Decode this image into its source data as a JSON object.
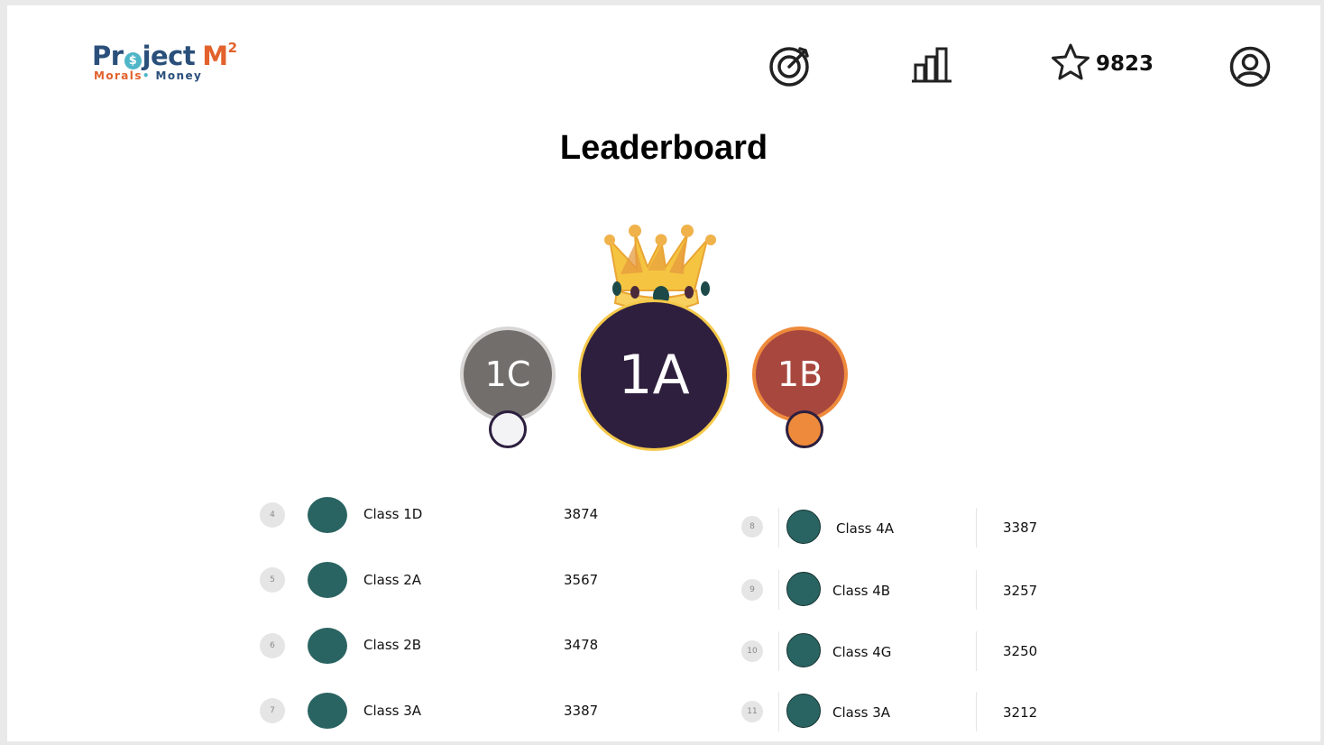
{
  "logo": {
    "part1": "Pr",
    "o": "$",
    "part2": "ject",
    "m": "M",
    "sup": "2",
    "tag_word1": "Morals",
    "tag_dot": "•",
    "tag_word2": "Money"
  },
  "header": {
    "icons": [
      "target-icon",
      "bar-chart-icon",
      "star-icon",
      "user-circle-icon"
    ],
    "stars": "9823"
  },
  "title": "Leaderboard",
  "podium": {
    "first": {
      "label": "1A",
      "color": "#2f1f3e",
      "ring": "#f5c94a"
    },
    "second": {
      "label": "1C",
      "color": "#726e6b",
      "ring": "#d9d6d6",
      "medal": "#f3f2f5"
    },
    "third": {
      "label": "1B",
      "color": "#a8473e",
      "ring": "#ee8a3c",
      "medal": "#ee8a3c"
    }
  },
  "left_list": [
    {
      "rank": "4",
      "name": "Class 1D",
      "score": "3874"
    },
    {
      "rank": "5",
      "name": "Class 2A",
      "score": "3567"
    },
    {
      "rank": "6",
      "name": "Class 2B",
      "score": "3478"
    },
    {
      "rank": "7",
      "name": "Class 3A",
      "score": "3387"
    }
  ],
  "right_list": [
    {
      "rank": "8",
      "name": "Class 4A",
      "score": "3387"
    },
    {
      "rank": "9",
      "name": "Class 4B",
      "score": "3257"
    },
    {
      "rank": "10",
      "name": "Class 4G",
      "score": "3250"
    },
    {
      "rank": "11",
      "name": "Class 3A",
      "score": "3212"
    }
  ],
  "colors": {
    "avatar": "#2a6462",
    "rank_badge": "#e5e5e5"
  }
}
